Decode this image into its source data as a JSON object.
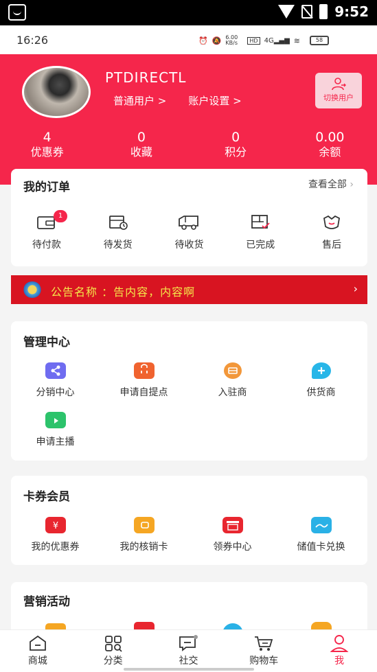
{
  "system_bar": {
    "time": "9:52"
  },
  "inner_status": {
    "time": "16:26",
    "speed": "6.00 KB/s",
    "battery": "58"
  },
  "profile": {
    "username": "PTDIRECTL",
    "role_link": "普通用户 >",
    "settings_link": "账户设置 >",
    "switch_label": "切换用户"
  },
  "stats": [
    {
      "value": "4",
      "label": "优惠券"
    },
    {
      "value": "0",
      "label": "收藏"
    },
    {
      "value": "0",
      "label": "积分"
    },
    {
      "value": "0.00",
      "label": "余额"
    }
  ],
  "orders": {
    "title": "我的订单",
    "see_all": "查看全部",
    "items": [
      {
        "label": "待付款",
        "badge": "1",
        "icon": "wallet-icon"
      },
      {
        "label": "待发货",
        "icon": "pending-box-icon"
      },
      {
        "label": "待收货",
        "icon": "truck-icon"
      },
      {
        "label": "已完成",
        "icon": "completed-box-icon"
      },
      {
        "label": "售后",
        "icon": "after-sales-icon"
      }
    ]
  },
  "notice": {
    "title": "公告名称",
    "content": "公告名称 ：告内容，内容啊"
  },
  "management": {
    "title": "管理中心",
    "items": [
      {
        "label": "分销中心",
        "icon": "share-icon",
        "color": "#6f6cf0"
      },
      {
        "label": "申请自提点",
        "icon": "shop-bag-icon",
        "color": "#f0632f"
      },
      {
        "label": "入驻商",
        "icon": "merchant-icon",
        "color": "#f2973a"
      },
      {
        "label": "供货商",
        "icon": "supplier-chat-icon",
        "color": "#28b6e8"
      },
      {
        "label": "申请主播",
        "icon": "tv-icon",
        "color": "#2cc36b"
      }
    ]
  },
  "vip": {
    "title": "卡券会员",
    "items": [
      {
        "label": "我的优惠券",
        "icon": "yen-coupon-icon",
        "color": "#e8262f"
      },
      {
        "label": "我的核销卡",
        "icon": "card-wallet-icon",
        "color": "#f5a623"
      },
      {
        "label": "领券中心",
        "icon": "coupon-box-icon",
        "color": "#e8262f"
      },
      {
        "label": "储值卡兑换",
        "icon": "card-exchange-icon",
        "color": "#2ab1e6"
      }
    ]
  },
  "marketing": {
    "title": "营销活动"
  },
  "tabbar": [
    {
      "label": "商城",
      "icon": "home-icon"
    },
    {
      "label": "分类",
      "icon": "category-icon"
    },
    {
      "label": "社交",
      "icon": "chat-icon"
    },
    {
      "label": "购物车",
      "icon": "cart-icon"
    },
    {
      "label": "我",
      "icon": "user-icon",
      "active": true
    }
  ]
}
